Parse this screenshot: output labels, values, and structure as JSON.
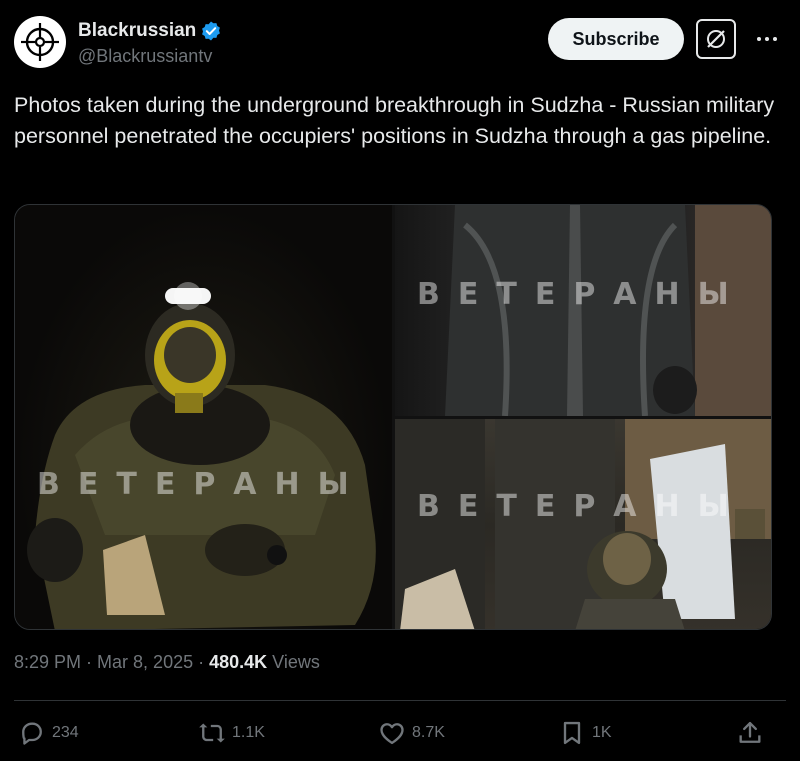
{
  "author": {
    "display_name": "Blackrussian",
    "handle": "@Blackrussiantv",
    "verified": true,
    "verified_color": "#1d9bf0"
  },
  "header": {
    "subscribe_label": "Subscribe"
  },
  "tweet": {
    "text": "Photos taken during the underground breakthrough in Sudzha - Russian military personnel penetrated the occupiers' positions in Sudzha through a gas pipeline.",
    "media_watermarks": [
      "ВЕТЕРАНЫ",
      "ВЕТЕРАНЫ",
      "ВЕТЕРАНЫ"
    ]
  },
  "meta": {
    "time": "8:29 PM",
    "separator": "·",
    "date": "Mar 8, 2025",
    "views_count": "480.4K",
    "views_label": "Views"
  },
  "actions": {
    "replies": "234",
    "reposts": "1.1K",
    "likes": "8.7K",
    "bookmarks": "1K"
  },
  "icons": [
    "crosshair-avatar-icon",
    "verified-badge-icon",
    "grok-icon",
    "more-icon",
    "reply-icon",
    "repost-icon",
    "like-icon",
    "bookmark-icon",
    "share-icon"
  ],
  "colors": {
    "background": "#000000",
    "text": "#e7e9ea",
    "secondary": "#71767b",
    "divider": "#2f3336"
  }
}
